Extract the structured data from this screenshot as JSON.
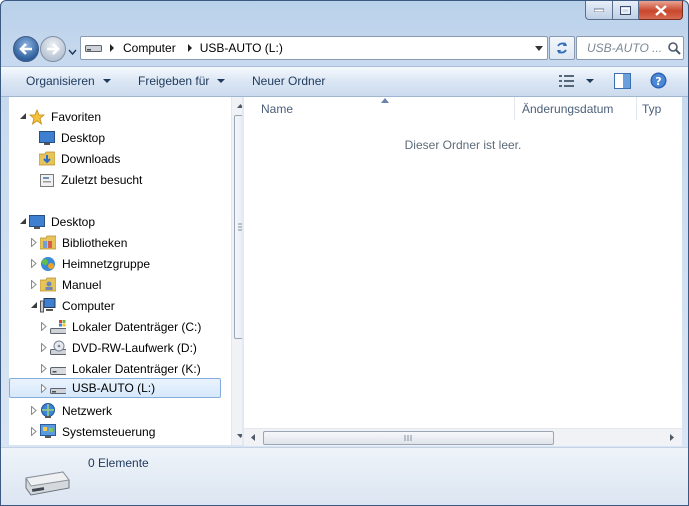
{
  "address": {
    "segments": [
      "Computer",
      "USB-AUTO (L:)"
    ]
  },
  "search": {
    "placeholder": "USB-AUTO ..."
  },
  "toolbar": {
    "organize": "Organisieren",
    "share": "Freigeben für",
    "new_folder": "Neuer Ordner"
  },
  "tree": {
    "favorites": "Favoriten",
    "desktop_fav": "Desktop",
    "downloads": "Downloads",
    "recent": "Zuletzt besucht",
    "desktop": "Desktop",
    "libraries": "Bibliotheken",
    "homegroup": "Heimnetzgruppe",
    "manuel": "Manuel",
    "computer": "Computer",
    "drive_c": "Lokaler Datenträger (C:)",
    "drive_d": "DVD-RW-Laufwerk (D:)",
    "drive_k": "Lokaler Datenträger (K:)",
    "drive_l": "USB-AUTO (L:)",
    "network": "Netzwerk",
    "control_panel": "Systemsteuerung"
  },
  "columns": {
    "name": "Name",
    "date": "Änderungsdatum",
    "type": "Typ"
  },
  "content": {
    "empty_message": "Dieser Ordner ist leer."
  },
  "details": {
    "count": "0 Elemente"
  },
  "colors": {
    "toolbar_text": "#1e395b",
    "selection_border": "#84acdd",
    "header_text": "#4c607a"
  }
}
